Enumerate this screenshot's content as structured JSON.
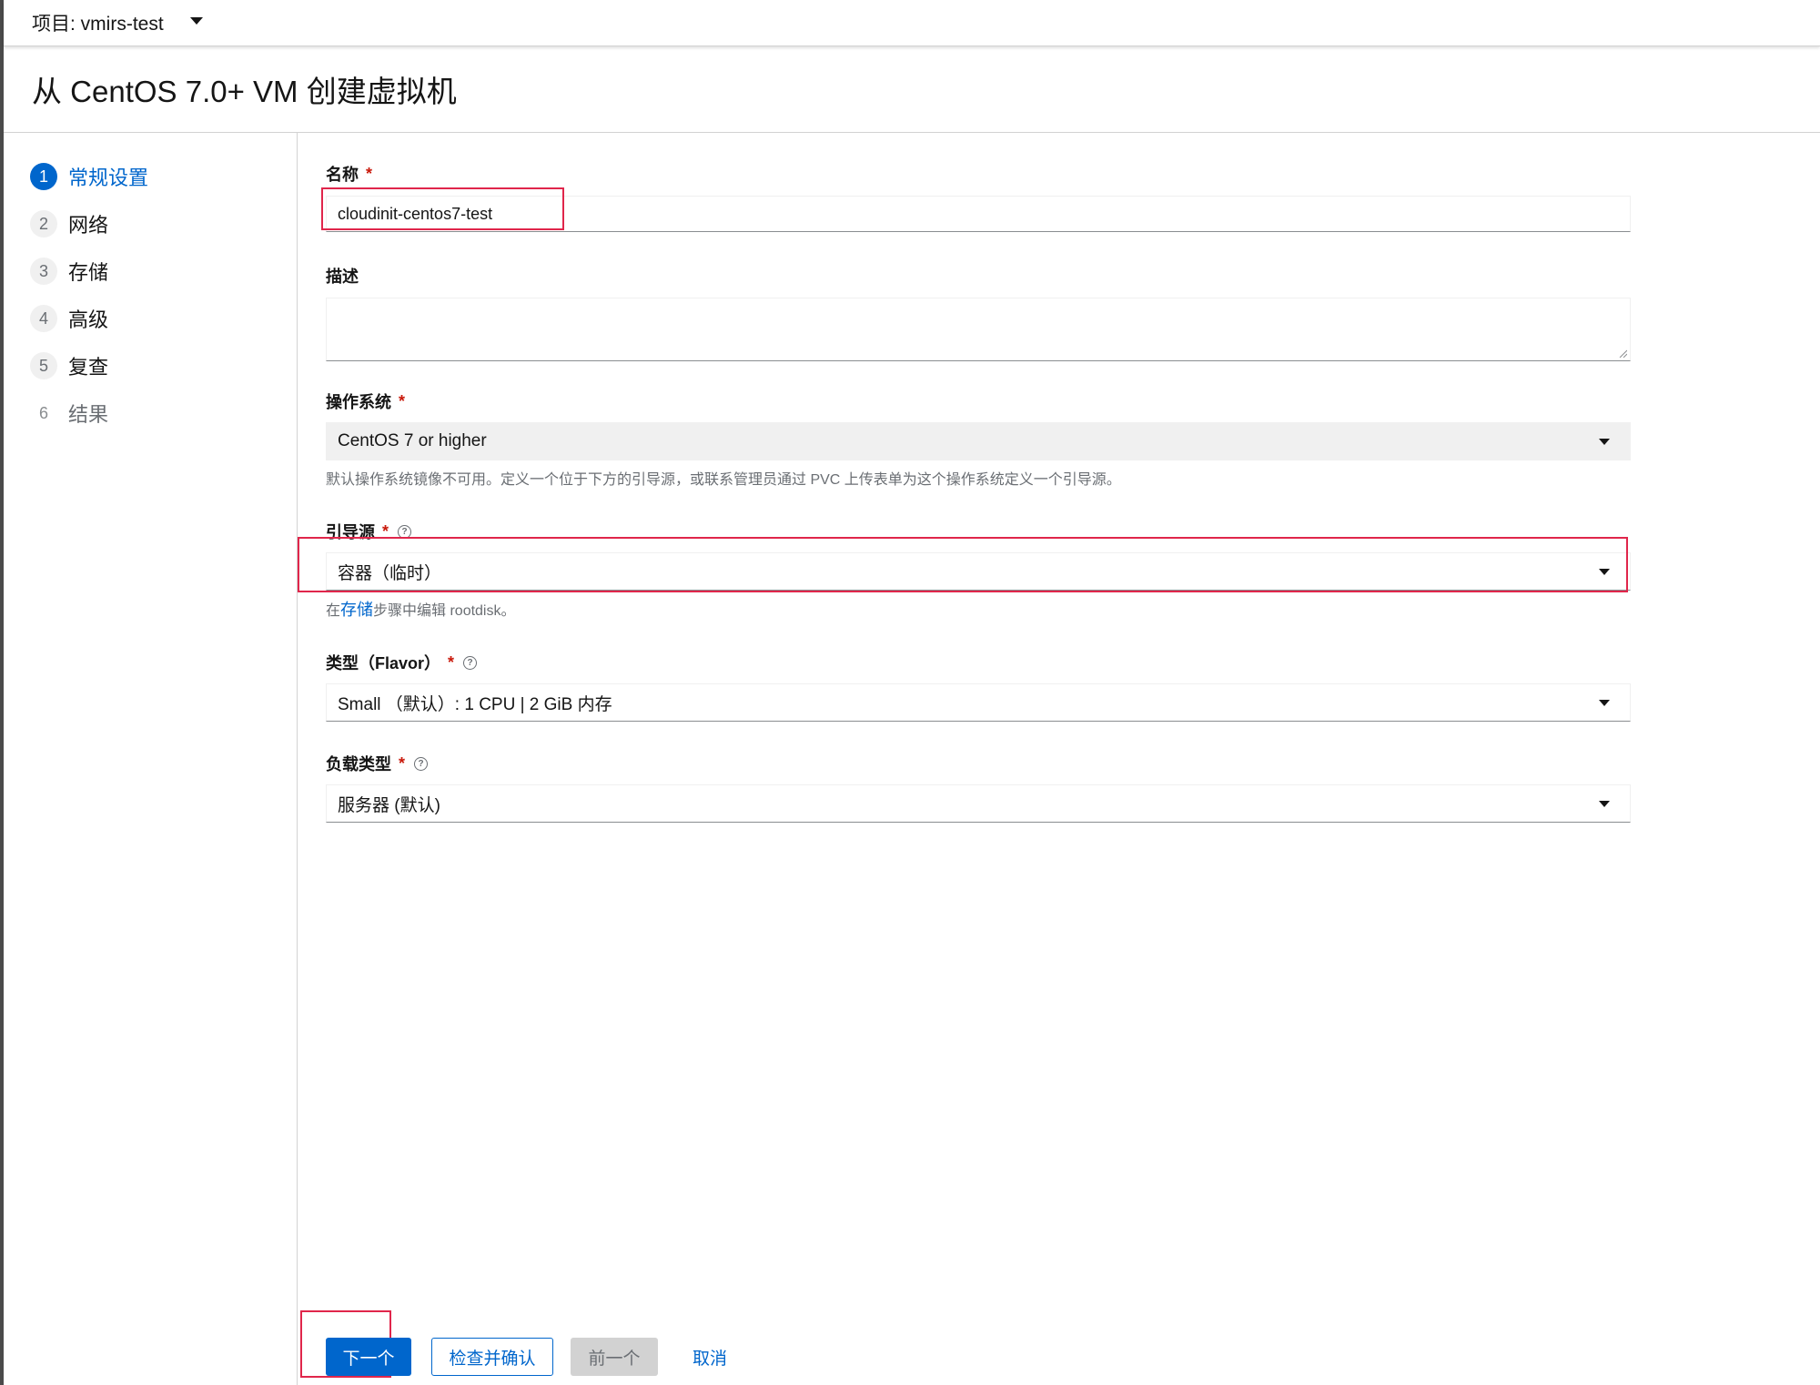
{
  "project": {
    "label": "项目: vmirs-test"
  },
  "page": {
    "title": "从 CentOS 7.0+ VM 创建虚拟机"
  },
  "wizard": {
    "steps": [
      {
        "num": "1",
        "label": "常规设置",
        "state": "active"
      },
      {
        "num": "2",
        "label": "网络",
        "state": "default"
      },
      {
        "num": "3",
        "label": "存储",
        "state": "default"
      },
      {
        "num": "4",
        "label": "高级",
        "state": "default"
      },
      {
        "num": "5",
        "label": "复查",
        "state": "default"
      },
      {
        "num": "6",
        "label": "结果",
        "state": "disabled"
      }
    ]
  },
  "form": {
    "name": {
      "label": "名称",
      "required": "*",
      "value": "cloudinit-centos7-test"
    },
    "description": {
      "label": "描述",
      "value": ""
    },
    "os": {
      "label": "操作系统",
      "required": "*",
      "value": "CentOS 7 or higher",
      "helper": "默认操作系统镜像不可用。定义一个位于下方的引导源，或联系管理员通过 PVC 上传表单为这个操作系统定义一个引导源。"
    },
    "boot_source": {
      "label": "引导源",
      "required": "*",
      "value": "容器（临时）",
      "helper_prefix": "在",
      "helper_link": "存储",
      "helper_suffix": "步骤中编辑 rootdisk。"
    },
    "flavor": {
      "label": "类型（Flavor）",
      "required": "*",
      "value": "Small （默认）: 1 CPU | 2 GiB 内存"
    },
    "workload": {
      "label": "负载类型",
      "required": "*",
      "value": "服务器 (默认)"
    }
  },
  "footer": {
    "next": "下一个",
    "review": "检查并确认",
    "back": "前一个",
    "cancel": "取消"
  },
  "colors": {
    "primary": "#0066cc",
    "required": "#c9190b",
    "highlight": "#e0264b"
  },
  "icons": {
    "dropdown": "caret-down-icon",
    "help": "question-circle-icon"
  }
}
